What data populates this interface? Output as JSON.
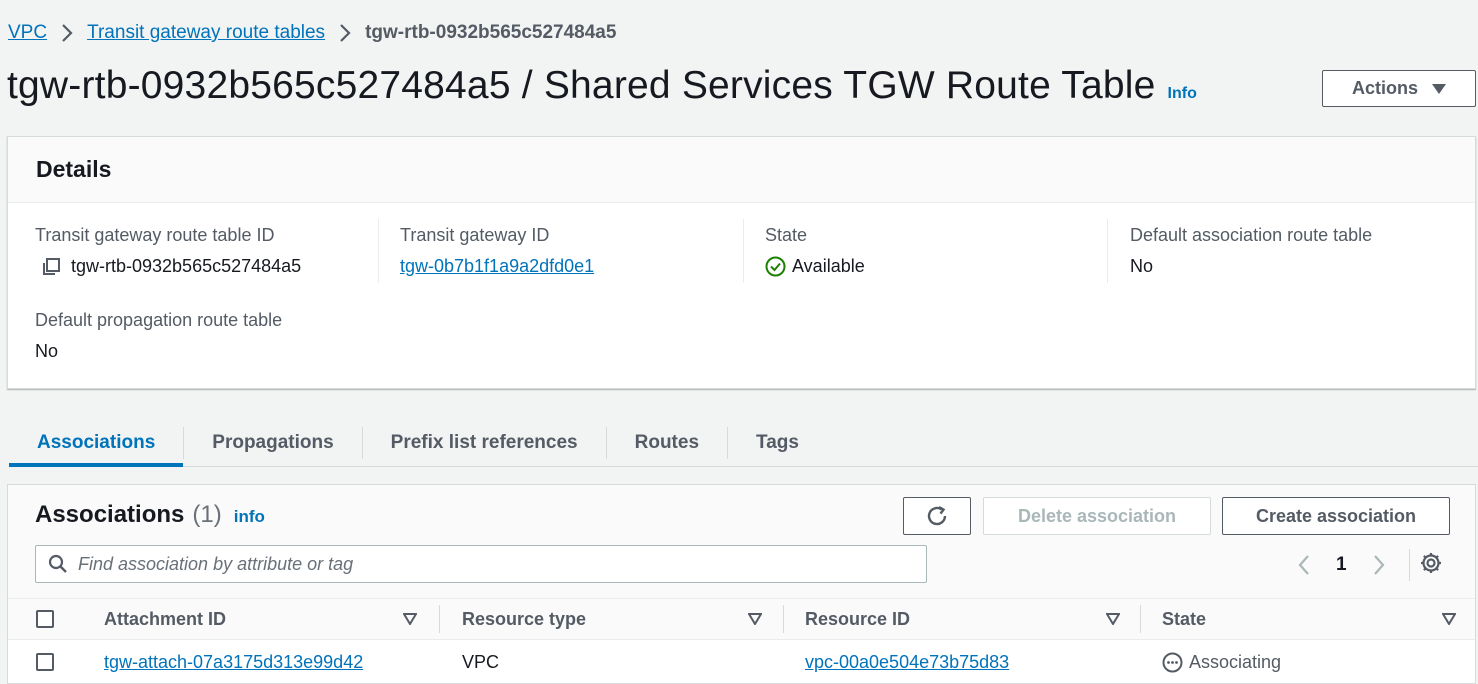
{
  "breadcrumb": {
    "items": [
      "VPC",
      "Transit gateway route tables"
    ],
    "current": "tgw-rtb-0932b565c527484a5"
  },
  "header": {
    "title": "tgw-rtb-0932b565c527484a5 / Shared Services TGW Route Table",
    "info": "Info",
    "actions_label": "Actions"
  },
  "details": {
    "heading": "Details",
    "fields": [
      {
        "label": "Transit gateway route table ID",
        "value": "tgw-rtb-0932b565c527484a5"
      },
      {
        "label": "Transit gateway ID",
        "value": "tgw-0b7b1f1a9a2dfd0e1"
      },
      {
        "label": "State",
        "value": "Available"
      },
      {
        "label": "Default association route table",
        "value": "No"
      },
      {
        "label": "Default propagation route table",
        "value": "No"
      }
    ]
  },
  "tabs": [
    "Associations",
    "Propagations",
    "Prefix list references",
    "Routes",
    "Tags"
  ],
  "associations": {
    "title": "Associations",
    "count": "(1)",
    "info": "info",
    "delete_label": "Delete association",
    "create_label": "Create association",
    "search_placeholder": "Find association by attribute or tag",
    "page": "1",
    "columns": [
      "Attachment ID",
      "Resource type",
      "Resource ID",
      "State"
    ],
    "rows": [
      {
        "attachment_id": "tgw-attach-07a3175d313e99d42",
        "resource_type": "VPC",
        "resource_id": "vpc-00a0e504e73b75d83",
        "state": "Associating"
      }
    ]
  },
  "colors": {
    "link": "#0073bb",
    "success": "#1d8102",
    "pending": "#545b64",
    "background": "#f2f3f3"
  },
  "icons": [
    "chevron-right-icon",
    "caret-down-icon",
    "copy-icon",
    "check-circle-icon",
    "refresh-icon",
    "search-icon",
    "chevron-left-icon",
    "settings-gear-icon",
    "sort-caret-icon",
    "ellipsis-circle-icon"
  ]
}
